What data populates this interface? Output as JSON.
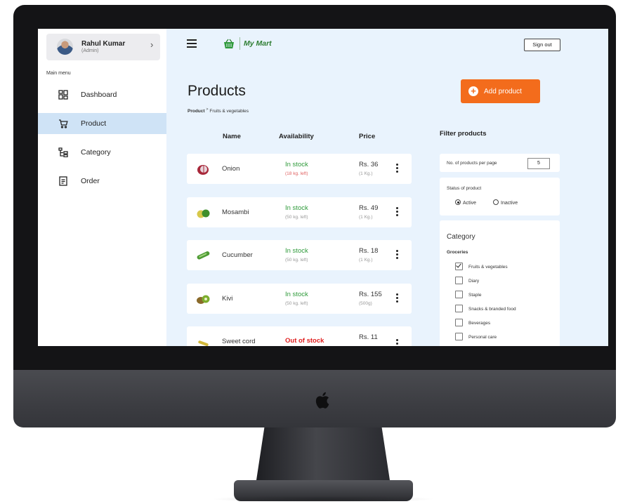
{
  "app": {
    "brand": "My Mart",
    "brand_color": "#2e7d32",
    "accent_color": "#f36c1c"
  },
  "user": {
    "name": "Rahul Kumar",
    "role": "(Admin)"
  },
  "sidebar": {
    "heading": "Main menu",
    "items": [
      {
        "label": "Dashboard",
        "icon": "dashboard-icon",
        "active": false
      },
      {
        "label": "Product",
        "icon": "cart-icon",
        "active": true
      },
      {
        "label": "Category",
        "icon": "category-tree-icon",
        "active": false
      },
      {
        "label": "Order",
        "icon": "order-list-icon",
        "active": false
      }
    ]
  },
  "header": {
    "signout_label": "Sign out"
  },
  "main": {
    "title": "Products",
    "breadcrumb": {
      "root": "Product",
      "separator": ">",
      "current": "Fruits & vegetables"
    },
    "add_button": "Add product",
    "columns": [
      "Name",
      "Availability",
      "Price"
    ],
    "products": [
      {
        "name": "Onion",
        "availability": "In stock",
        "stock_note": "(18 kg. left)",
        "price": "Rs. 36",
        "unit": "(1 Kg.)",
        "in_stock": true
      },
      {
        "name": "Mosambi",
        "availability": "In stock",
        "stock_note": "(50 kg. left)",
        "price": "Rs. 49",
        "unit": "(1 Kg.)",
        "in_stock": true
      },
      {
        "name": "Cucumber",
        "availability": "In stock",
        "stock_note": "(50 kg. left)",
        "price": "Rs. 18",
        "unit": "(1 Kg.)",
        "in_stock": true
      },
      {
        "name": "Kivi",
        "availability": "In stock",
        "stock_note": "(50 kg. left)",
        "price": "Rs. 155",
        "unit": "(500g)",
        "in_stock": true
      },
      {
        "name": "Sweet cord",
        "availability": "Out of stock",
        "stock_note": "",
        "price": "Rs. 11",
        "unit": "",
        "in_stock": false
      }
    ]
  },
  "filter": {
    "title": "Filter products",
    "per_page_label": "No. of products per page",
    "per_page_value": "5",
    "status_label": "Status of product",
    "status_options": [
      {
        "label": "Active",
        "selected": true
      },
      {
        "label": "Inactive",
        "selected": false
      }
    ],
    "category_title": "Category",
    "group": "Groceries",
    "categories": [
      {
        "label": "Fruits & vegetables",
        "checked": true
      },
      {
        "label": "Diary",
        "checked": false
      },
      {
        "label": "Staple",
        "checked": false
      },
      {
        "label": "Snacks & branded food",
        "checked": false
      },
      {
        "label": "Beverages",
        "checked": false
      },
      {
        "label": "Personal care",
        "checked": false
      }
    ]
  }
}
